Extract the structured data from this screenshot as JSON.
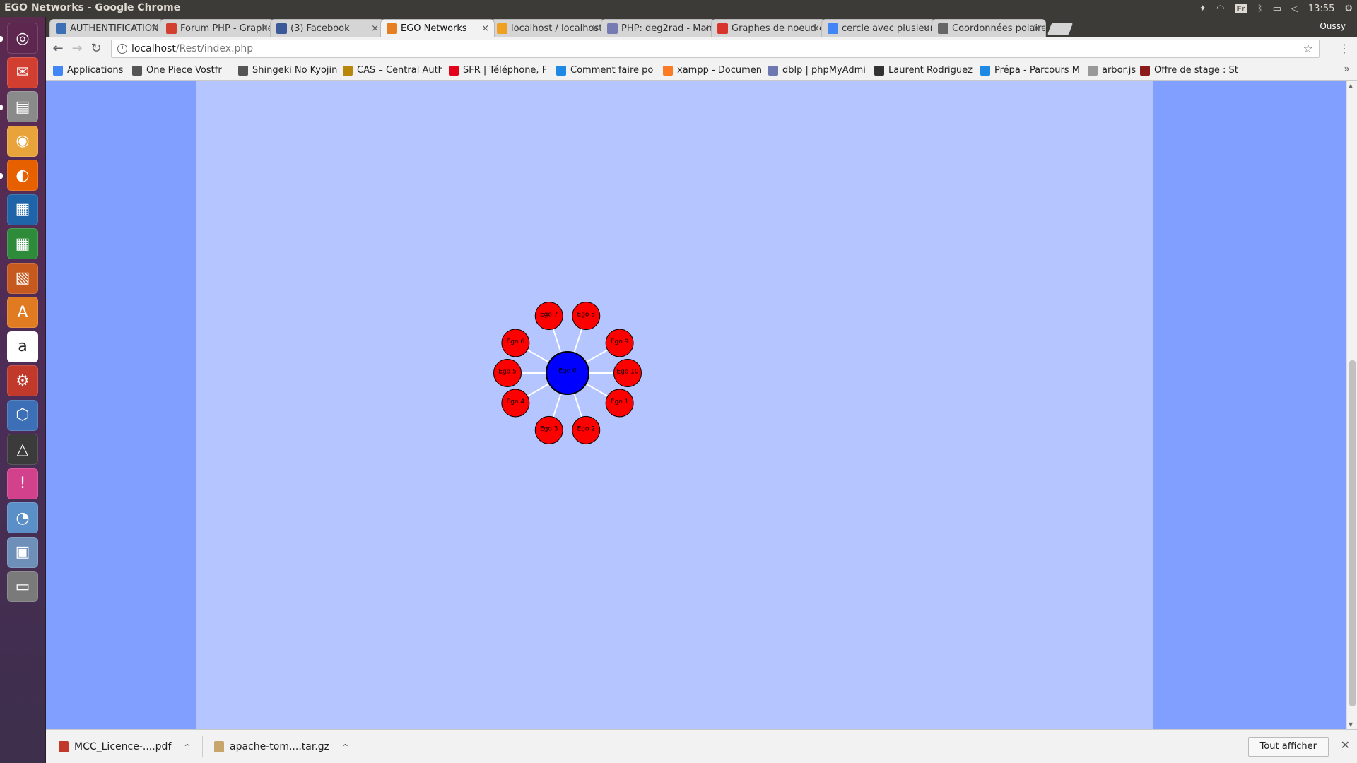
{
  "window": {
    "title": "EGO Networks - Google Chrome"
  },
  "system_tray": {
    "lang": "Fr",
    "clock": "13:55",
    "user": "Oussy"
  },
  "launcher": {
    "items": [
      {
        "name": "ubuntu-dash-icon",
        "color": "#5e2750"
      },
      {
        "name": "mail-icon",
        "color": "#d23f31"
      },
      {
        "name": "files-icon",
        "color": "#8a8a8a"
      },
      {
        "name": "chrome-icon",
        "color": "#e8a33b"
      },
      {
        "name": "firefox-icon",
        "color": "#e66000"
      },
      {
        "name": "writer-icon",
        "color": "#1f63a8"
      },
      {
        "name": "calc-icon",
        "color": "#2e8b3a"
      },
      {
        "name": "impress-icon",
        "color": "#c65a1e"
      },
      {
        "name": "software-center-icon",
        "color": "#e07b22"
      },
      {
        "name": "amazon-icon",
        "color": "#ffffff"
      },
      {
        "name": "system-settings-icon",
        "color": "#c0392b"
      },
      {
        "name": "virtualbox-icon",
        "color": "#3d6fb6"
      },
      {
        "name": "inkscape-icon",
        "color": "#3b3b3b"
      },
      {
        "name": "app-icon-pink",
        "color": "#d2418b"
      },
      {
        "name": "postgres-icon",
        "color": "#5a8fc8"
      },
      {
        "name": "workspace-icon",
        "color": "#6d8fb8"
      },
      {
        "name": "trash-icon",
        "color": "#7a7a7a"
      }
    ]
  },
  "tabs": [
    {
      "label": "AUTHENTIFICATION",
      "icon_color": "#3b6fb6",
      "active": false
    },
    {
      "label": "Forum PHP - Graphe",
      "icon_color": "#d23f31",
      "active": false
    },
    {
      "label": "(3) Facebook",
      "icon_color": "#3b5998",
      "active": false
    },
    {
      "label": "EGO Networks",
      "icon_color": "#e67e22",
      "active": true
    },
    {
      "label": "localhost / localhost",
      "icon_color": "#f0a020",
      "active": false
    },
    {
      "label": "PHP: deg2rad - Manu",
      "icon_color": "#777bb3",
      "active": false
    },
    {
      "label": "Graphes de noeud en",
      "icon_color": "#d9342b",
      "active": false
    },
    {
      "label": "cercle avec plusieurs",
      "icon_color": "#4285f4",
      "active": false
    },
    {
      "label": "Coordonnées polaires",
      "icon_color": "#666666",
      "active": false
    }
  ],
  "tab_close_glyph": "×",
  "omnibox": {
    "host": "localhost",
    "path": "/Rest/index.php"
  },
  "bookmarks": [
    {
      "label": "Applications",
      "icon_color": "#4285f4"
    },
    {
      "label": "One Piece Vostfr",
      "icon_color": "#555555"
    },
    {
      "label": "Shingeki No Kyojin",
      "icon_color": "#555555"
    },
    {
      "label": "CAS – Central Auth",
      "icon_color": "#b8860b"
    },
    {
      "label": "SFR | Téléphone, F",
      "icon_color": "#e2001a"
    },
    {
      "label": "Comment faire po",
      "icon_color": "#1e88e5"
    },
    {
      "label": "xampp - Documen",
      "icon_color": "#fb7a24"
    },
    {
      "label": "dblp | phpMyAdmi",
      "icon_color": "#6c78af"
    },
    {
      "label": "Laurent Rodriguez",
      "icon_color": "#333333"
    },
    {
      "label": "Prépa - Parcours M",
      "icon_color": "#1e88e5"
    },
    {
      "label": "arbor.js",
      "icon_color": "#999999"
    },
    {
      "label": "Offre de stage : St",
      "icon_color": "#8b1a1a"
    }
  ],
  "graph": {
    "center": {
      "label": "Ego 0",
      "color": "#0000ff"
    },
    "nodes": [
      {
        "label": "Ego 1",
        "angle_deg": 30
      },
      {
        "label": "Ego 2",
        "angle_deg": 72
      },
      {
        "label": "Ego 3",
        "angle_deg": 108
      },
      {
        "label": "Ego 4",
        "angle_deg": 150
      },
      {
        "label": "Ego 5",
        "angle_deg": 180
      },
      {
        "label": "Ego 6",
        "angle_deg": 210
      },
      {
        "label": "Ego 7",
        "angle_deg": 252
      },
      {
        "label": "Ego 8",
        "angle_deg": 288
      },
      {
        "label": "Ego 9",
        "angle_deg": 330
      },
      {
        "label": "Ego 10",
        "angle_deg": 0
      }
    ],
    "node_color": "#ff0000",
    "edge_color": "#ffffff"
  },
  "downloads": {
    "items": [
      {
        "label": "MCC_Licence-....pdf",
        "icon_color": "#c0392b"
      },
      {
        "label": "apache-tom....tar.gz",
        "icon_color": "#c8a56a"
      }
    ],
    "show_all_label": "Tout afficher"
  }
}
